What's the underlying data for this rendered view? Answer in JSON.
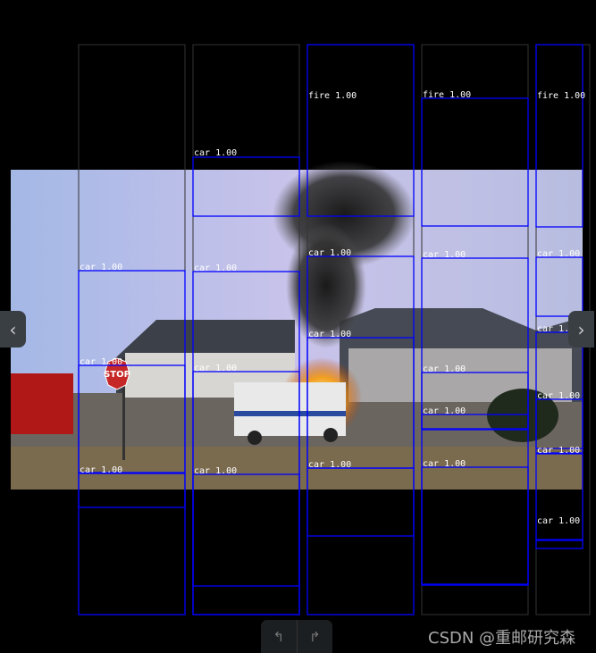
{
  "detections": [
    {
      "label": "car 1.00"
    },
    {
      "label": "car 1.00"
    },
    {
      "label": "car 1.00"
    },
    {
      "label": "fire 1.00"
    },
    {
      "label": "fire 1.00"
    },
    {
      "label": "fire 1.00"
    },
    {
      "label": "car 1.00"
    },
    {
      "label": "car 1.00"
    },
    {
      "label": "car 1.00"
    },
    {
      "label": "car 1.00"
    },
    {
      "label": "car 1.00"
    },
    {
      "label": "car 1.00"
    },
    {
      "label": "car 1.00"
    },
    {
      "label": "car 1.00"
    },
    {
      "label": "car 1.00"
    },
    {
      "label": "car 1.00"
    },
    {
      "label": "car 1.00"
    },
    {
      "label": "car 1.00"
    },
    {
      "label": "car 1.00"
    },
    {
      "label": "car 1.00"
    },
    {
      "label": "car 1.00"
    },
    {
      "label": "car 1.00"
    }
  ],
  "image_sign_text": "STOP",
  "box_color": "#0000ff",
  "nav": {
    "prev_icon": "chevron-left-icon",
    "next_icon": "chevron-right-icon"
  },
  "toolbar": {
    "undo_icon": "rotate-left-icon",
    "redo_icon": "rotate-right-icon",
    "undo": "↰",
    "redo": "↱"
  },
  "watermark": "CSDN @重邮研究森"
}
